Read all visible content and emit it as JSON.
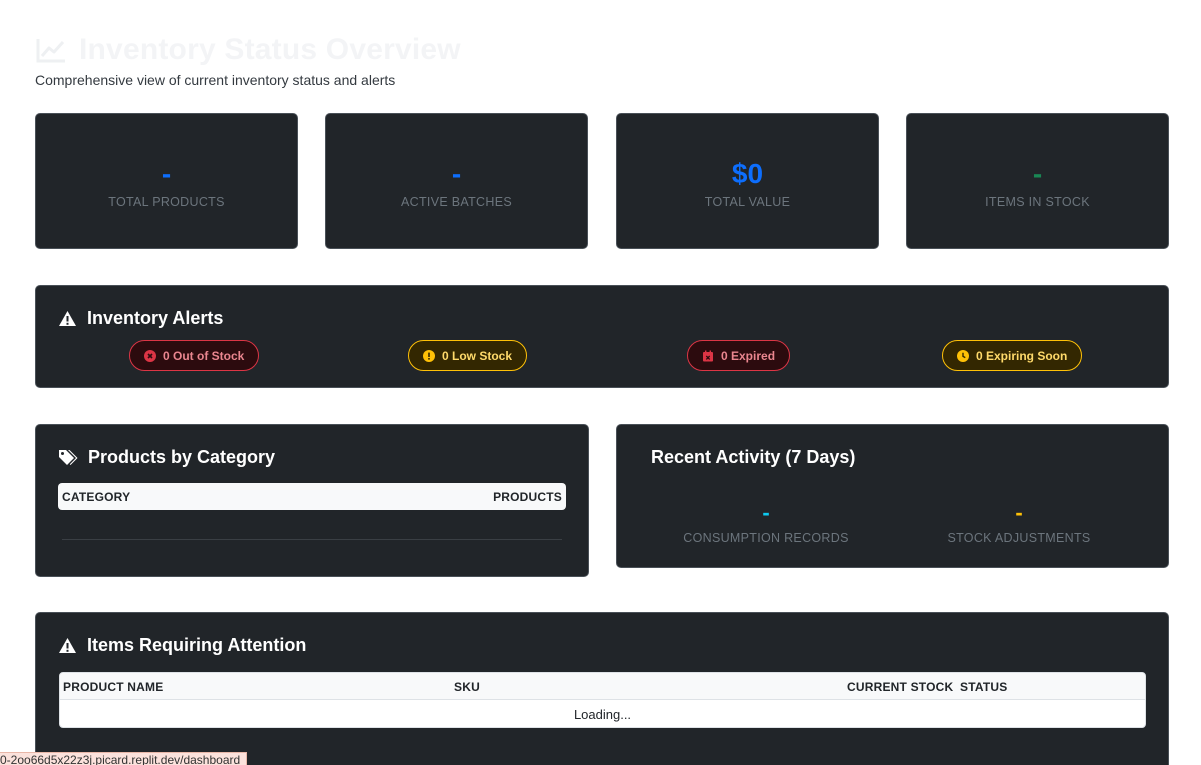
{
  "header": {
    "title": "Inventory Status Overview",
    "subtitle": "Comprehensive view of current inventory status and alerts"
  },
  "stats": [
    {
      "value": "-",
      "label": "TOTAL PRODUCTS",
      "color": "#0d6efd"
    },
    {
      "value": "-",
      "label": "ACTIVE BATCHES",
      "color": "#0d6efd"
    },
    {
      "value": "$0",
      "label": "TOTAL VALUE",
      "color": "#0d6efd"
    },
    {
      "value": "-",
      "label": "ITEMS IN STOCK",
      "color": "#198754"
    }
  ],
  "alerts": {
    "title": "Inventory Alerts",
    "badges": [
      {
        "label": "0 Out of Stock",
        "icon": "x-circle-icon"
      },
      {
        "label": "0 Low Stock",
        "icon": "exclamation-circle-icon"
      },
      {
        "label": "0 Expired",
        "icon": "calendar-x-icon"
      },
      {
        "label": "0 Expiring Soon",
        "icon": "clock-icon"
      }
    ]
  },
  "categories": {
    "title": "Products by Category",
    "columns": [
      "CATEGORY",
      "PRODUCTS"
    ]
  },
  "activity": {
    "title": "Recent Activity (7 Days)",
    "consumption": {
      "value": "-",
      "label": "CONSUMPTION RECORDS"
    },
    "adjustments": {
      "value": "-",
      "label": "STOCK ADJUSTMENTS"
    }
  },
  "attention": {
    "title": "Items Requiring Attention",
    "columns": [
      "PRODUCT NAME",
      "SKU",
      "CURRENT STOCK",
      "STATUS"
    ],
    "loading_text": "Loading..."
  },
  "status_bar": {
    "url": "0-2oo66d5x22z3j.picard.replit.dev/dashboard"
  }
}
